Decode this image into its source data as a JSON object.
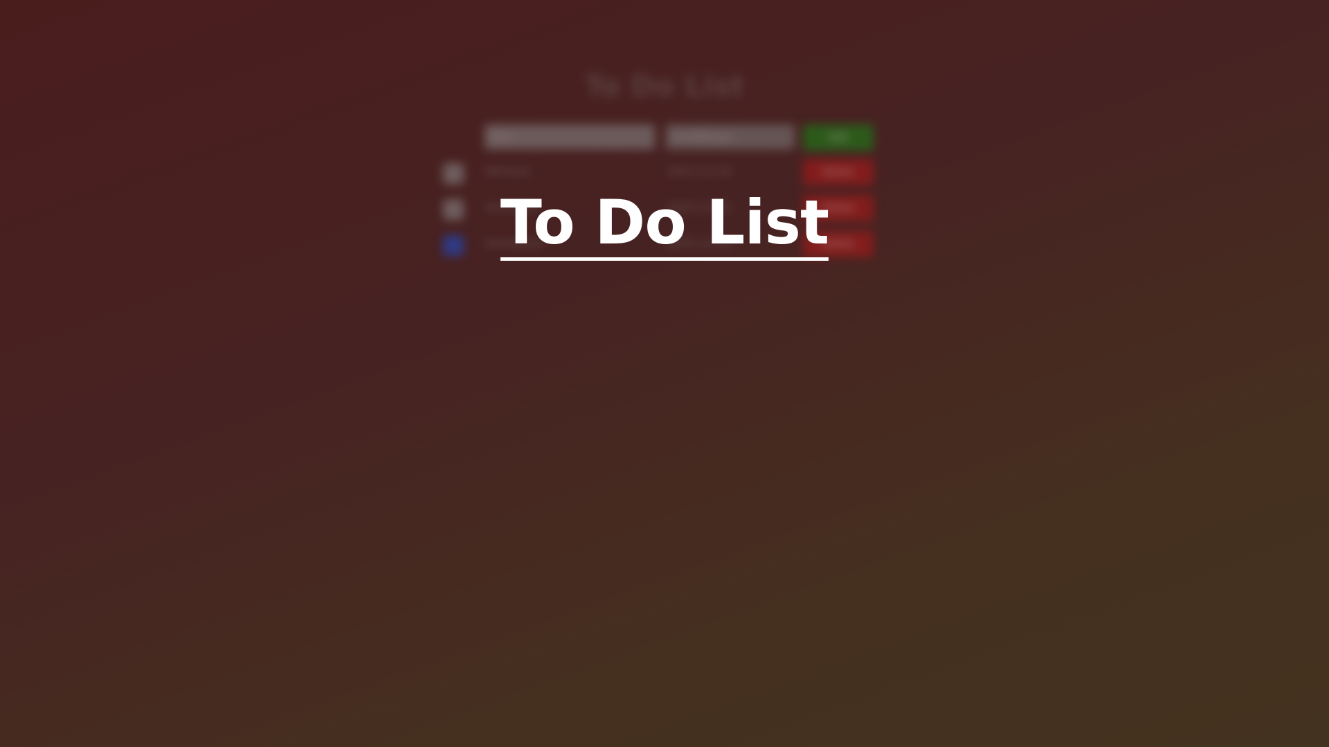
{
  "app": {
    "title": "To Do List"
  },
  "background": {
    "title": "To Do List",
    "new_todo": {
      "placeholder": "Todo",
      "due_placeholder": "mm/dd/yyyy"
    },
    "add_label": "Add",
    "todos": [
      {
        "name": "Workout",
        "due": "2023-12-20",
        "done": false,
        "delete_label": "Delete"
      },
      {
        "name": "Groceries",
        "due": "2023-12-21",
        "done": false,
        "delete_label": "Delete"
      },
      {
        "name": "Homework",
        "due": "2023-12-22",
        "done": true,
        "delete_label": "Delete"
      }
    ]
  },
  "colors": {
    "background_top": "#4a1d1d",
    "background_bottom": "#43321f",
    "add_button": "#168a16",
    "delete_button": "#b41818",
    "checkbox_checked": "#1c4fd6",
    "title_text": "#ffffff"
  }
}
